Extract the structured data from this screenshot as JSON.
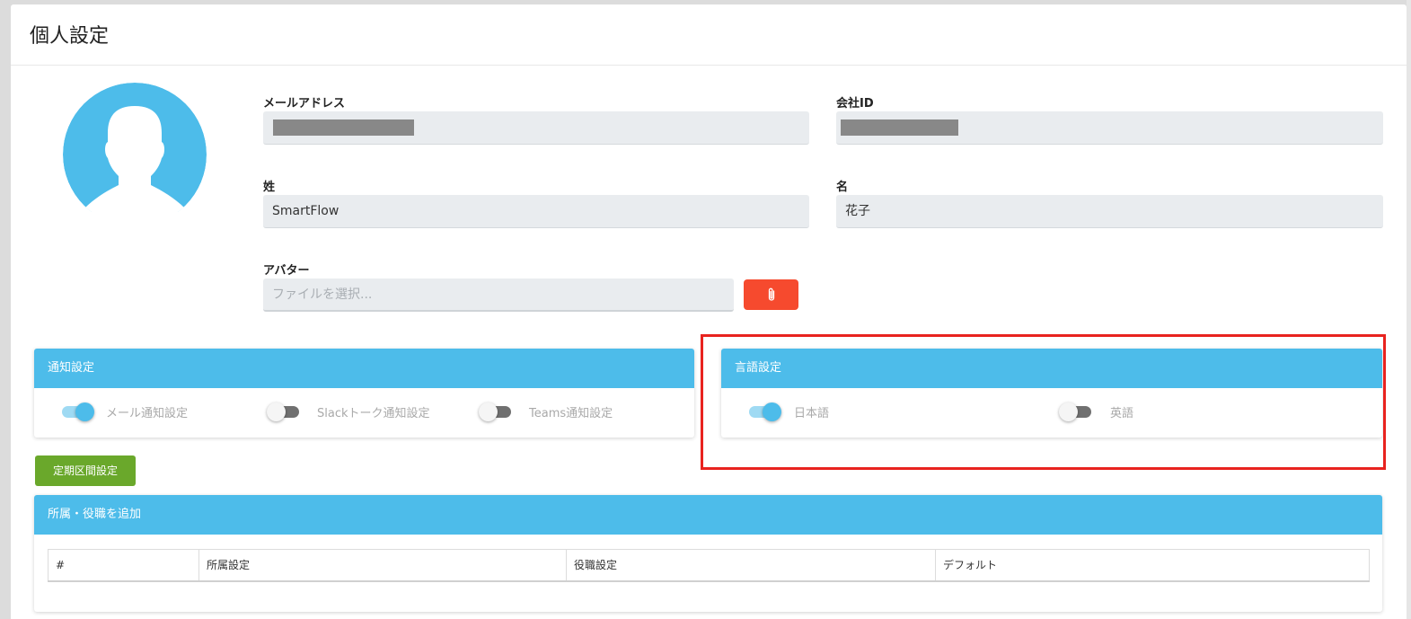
{
  "page": {
    "title": "個人設定"
  },
  "avatar": {
    "icon": "user-silhouette-icon"
  },
  "fields": {
    "email": {
      "label": "メールアドレス"
    },
    "company_id": {
      "label": "会社ID"
    },
    "last_name": {
      "label": "姓",
      "value": "SmartFlow"
    },
    "first_name": {
      "label": "名",
      "value": "花子"
    },
    "avatar_upload": {
      "label": "アバター",
      "placeholder": "ファイルを選択...",
      "button_icon": "paperclip-icon"
    }
  },
  "notification_panel": {
    "title": "通知設定",
    "toggles": [
      {
        "label": "メール通知設定",
        "on": true
      },
      {
        "label": "Slackトーク通知設定",
        "on": false
      },
      {
        "label": "Teams通知設定",
        "on": false
      }
    ]
  },
  "language_panel": {
    "title": "言語設定",
    "toggles": [
      {
        "label": "日本語",
        "on": true
      },
      {
        "label": "英語",
        "on": false
      }
    ]
  },
  "periodic_button": {
    "label": "定期区間設定"
  },
  "assignment_panel": {
    "title": "所属・役職を追加",
    "columns": [
      "#",
      "所属設定",
      "役職設定",
      "デフォルト"
    ]
  },
  "colors": {
    "panel_header": "#4dbcea",
    "attach_button": "#f64a2e",
    "green_button": "#6aa82b",
    "highlight": "#e8231f"
  }
}
